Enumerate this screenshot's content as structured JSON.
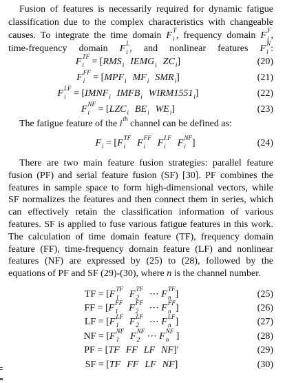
{
  "paragraph1": [
    [
      "Fusion of features is necessarily required for dynamic fatigue"
    ],
    [
      "classification due to the complex characteristics with changeable"
    ],
    [
      "causes. To integrate the time domain ",
      {
        "t": "F",
        "sup": "T",
        "sub": "i"
      },
      ", frequency domain ",
      {
        "t": "F",
        "sup": "F",
        "sub": "i"
      },
      ","
    ],
    [
      "time-frequency domain ",
      {
        "t": "F",
        "sup": "L",
        "sub": "i"
      },
      ", and nonlinear features ",
      {
        "t": "F",
        "sup": "N",
        "sub": "i"
      },
      ":"
    ]
  ],
  "equations_a": [
    {
      "number": "(20)",
      "tokens": [
        {
          "t": "F",
          "sup": "TF",
          "sub": "i"
        },
        {
          "u": " = ["
        },
        {
          "t": "RMS",
          "sub": "i"
        },
        {
          "g": 1
        },
        {
          "t": "IEMG",
          "sub": "i"
        },
        {
          "g": 1
        },
        {
          "t": "ZC",
          "sub": "i"
        },
        {
          "u": "]"
        }
      ]
    },
    {
      "number": "(21)",
      "tokens": [
        {
          "t": "F",
          "sup": "FF",
          "sub": "i"
        },
        {
          "u": " = ["
        },
        {
          "t": "MPF",
          "sub": "i"
        },
        {
          "g": 1
        },
        {
          "t": "MF",
          "sub": "i"
        },
        {
          "g": 1
        },
        {
          "t": "SMR",
          "sub": "i"
        },
        {
          "u": "]"
        }
      ]
    },
    {
      "number": "(22)",
      "tokens": [
        {
          "t": "F",
          "sup": "LF",
          "sub": "i"
        },
        {
          "u": " = ["
        },
        {
          "t": "IMNF",
          "sub": "i"
        },
        {
          "g": 1
        },
        {
          "t": "IMFB",
          "sub": "i"
        },
        {
          "g": 1
        },
        {
          "t": "WIRM1551",
          "sub": "i"
        },
        {
          "u": "]"
        }
      ]
    },
    {
      "number": "(23)",
      "tokens": [
        {
          "t": "F",
          "sup": "NF",
          "sub": "i"
        },
        {
          "u": " = ["
        },
        {
          "t": "LZC",
          "sub": "i"
        },
        {
          "g": 1
        },
        {
          "t": "BE",
          "sub": "i"
        },
        {
          "g": 1
        },
        {
          "t": "WE",
          "sub": "i"
        },
        {
          "u": "]"
        }
      ]
    }
  ],
  "channel_line": [
    "The fatigue feature of the ",
    {
      "t": "i",
      "sup": "th"
    },
    " channel can be defined as:"
  ],
  "equation_24": {
    "number": "(24)",
    "tokens": [
      {
        "t": "F",
        "sub": "i"
      },
      {
        "u": " = ["
      },
      {
        "t": "F",
        "sup": "TF",
        "sub": "i"
      },
      {
        "g": 1
      },
      {
        "t": "F",
        "sup": "FF",
        "sub": "i"
      },
      {
        "g": 1
      },
      {
        "t": "F",
        "sup": "LF",
        "sub": "i"
      },
      {
        "g": 1
      },
      {
        "t": "F",
        "sup": "NF",
        "sub": "i"
      },
      {
        "u": "]"
      }
    ]
  },
  "paragraph2": [
    [
      "There are two main feature fusion strategies: parallel feature"
    ],
    [
      "fusion (PF) and serial feature fusion (SF) [30]. PF combines the"
    ],
    [
      "features in sample space to form high-dimensional vectors, while"
    ],
    [
      "SF normalizes the features and then connect them in series, which"
    ],
    [
      "can effectively retain the classification information of various"
    ],
    [
      "features. SF is applied to fuse various fatigue features in this work."
    ],
    [
      "The calculation of time domain feature (TF), frequency domain"
    ],
    [
      "feature (FF), time-frequency domain feature (LF) and nonlinear"
    ],
    [
      "features (NF) are expressed by (25) to (28), followed by the"
    ],
    [
      "equations of PF and SF (29)-(30), where ",
      {
        "t": "n"
      },
      " is the channel number."
    ]
  ],
  "equations_b": [
    {
      "number": "(25)",
      "tokens": [
        {
          "u": "TF = ["
        },
        {
          "t": "F",
          "sup": "TF",
          "sub": "1"
        },
        {
          "g": 1
        },
        {
          "t": "F",
          "sup": "TF",
          "sub": "2"
        },
        {
          "g": 1
        },
        {
          "u": "⋯ "
        },
        {
          "t": "F",
          "sup": "TF",
          "sub": "n"
        },
        {
          "u": "]"
        }
      ]
    },
    {
      "number": "(26)",
      "tokens": [
        {
          "u": "FF = ["
        },
        {
          "t": "F",
          "sup": "FF",
          "sub": "1"
        },
        {
          "g": 1
        },
        {
          "t": "F",
          "sup": "FF",
          "sub": "2"
        },
        {
          "g": 1
        },
        {
          "u": "⋯ "
        },
        {
          "t": "F",
          "sup": "FF",
          "sub": "n"
        },
        {
          "u": "]"
        }
      ]
    },
    {
      "number": "(27)",
      "tokens": [
        {
          "u": "LF = ["
        },
        {
          "t": "F",
          "sup": "LF",
          "sub": "1"
        },
        {
          "g": 1
        },
        {
          "t": "F",
          "sup": "LF",
          "sub": "2"
        },
        {
          "g": 1
        },
        {
          "u": "⋯ "
        },
        {
          "t": "F",
          "sup": "LF",
          "sub": "n"
        },
        {
          "u": "]"
        }
      ]
    },
    {
      "number": "(28)",
      "tokens": [
        {
          "u": "NF = ["
        },
        {
          "t": "F",
          "sup": "NF",
          "sub": "1"
        },
        {
          "g": 1
        },
        {
          "t": "F",
          "sup": "NF",
          "sub": "2"
        },
        {
          "u": " ⋯ "
        },
        {
          "t": "F",
          "sup": "NF",
          "sub": "n"
        },
        {
          "u": " ]"
        }
      ]
    },
    {
      "number": "(29)",
      "tokens": [
        {
          "u": "PF = ["
        },
        {
          "t": "TF"
        },
        {
          "g": 1
        },
        {
          "t": "FF"
        },
        {
          "g": 1
        },
        {
          "t": "LF"
        },
        {
          "g": 1
        },
        {
          "t": "NF"
        },
        {
          "u": "]′"
        }
      ]
    },
    {
      "number": "(30)",
      "tokens": [
        {
          "u": "SF = ["
        },
        {
          "t": "TF"
        },
        {
          "g": 1
        },
        {
          "t": "FF"
        },
        {
          "g": 1
        },
        {
          "t": "LF"
        },
        {
          "g": 1
        },
        {
          "t": "NF"
        },
        {
          "u": "]"
        }
      ]
    }
  ]
}
